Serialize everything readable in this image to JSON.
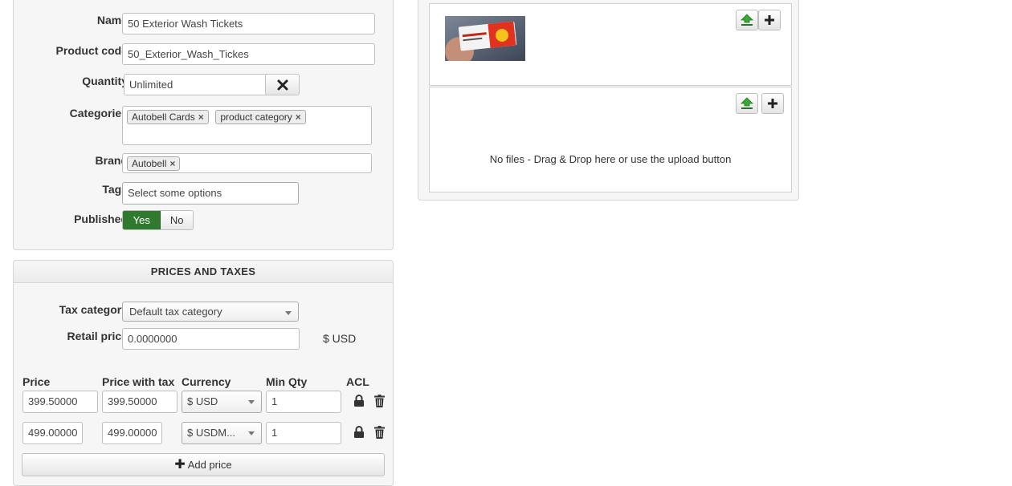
{
  "product_form": {
    "name": {
      "label": "Name",
      "value": "50 Exterior Wash Tickets"
    },
    "product_code": {
      "label": "Product code",
      "value": "50_Exterior_Wash_Tickes"
    },
    "quantity": {
      "label": "Quantity",
      "value": "Unlimited"
    },
    "categories": {
      "label": "Categories",
      "chips": [
        "Autobell Cards",
        "product category"
      ]
    },
    "brand": {
      "label": "Brand",
      "chips": [
        "Autobell"
      ]
    },
    "tags": {
      "label": "Tags",
      "placeholder": "Select some options"
    },
    "published": {
      "label": "Published",
      "yes": "Yes",
      "no": "No",
      "selected": "Yes"
    }
  },
  "prices_and_taxes": {
    "title": "PRICES AND TAXES",
    "tax_category": {
      "label": "Tax category",
      "value": "Default tax category"
    },
    "retail_price": {
      "label": "Retail price",
      "value": "0.0000000",
      "currency": "$ USD"
    },
    "columns": [
      "Price",
      "Price with tax",
      "Currency",
      "Min Qty",
      "ACL"
    ],
    "rows": [
      {
        "price": "399.50000",
        "price_with_tax": "399.50000",
        "currency": "$ USD",
        "min_qty": "1"
      },
      {
        "price": "499.00000",
        "price_with_tax": "499.00000",
        "currency": "$ USDM...",
        "min_qty": "1"
      }
    ],
    "add_price_label": "Add price"
  },
  "images": {
    "empty_message": "No files - Drag & Drop here or use the upload button"
  },
  "colors": {
    "published_yes_bg": "#2f7a2f",
    "upload_icon_green": "#3aa735"
  }
}
